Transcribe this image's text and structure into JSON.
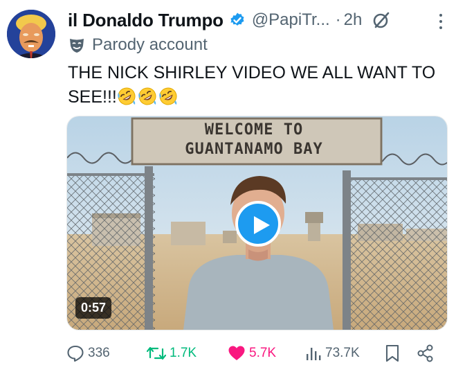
{
  "post": {
    "author_name": "il Donaldo Trumpo",
    "handle": "@PapiTr...",
    "separator": "·",
    "time": "2h",
    "account_label": "Parody account",
    "text": "THE NICK SHIRLEY VIDEO WE ALL WANT TO SEE!!!",
    "emoji_count": 3,
    "emoji_name": "rolling-on-floor-laughing"
  },
  "media": {
    "sign_line1": "WELCOME TO",
    "sign_line2": "GUANTANAMO BAY",
    "duration": "0:57"
  },
  "actions": {
    "replies": "336",
    "reposts": "1.7K",
    "likes": "5.7K",
    "views": "73.7K"
  },
  "colors": {
    "verified": "#1d9bf0",
    "repost": "#00ba7c",
    "like": "#f91880",
    "secondary_text": "#536471"
  }
}
